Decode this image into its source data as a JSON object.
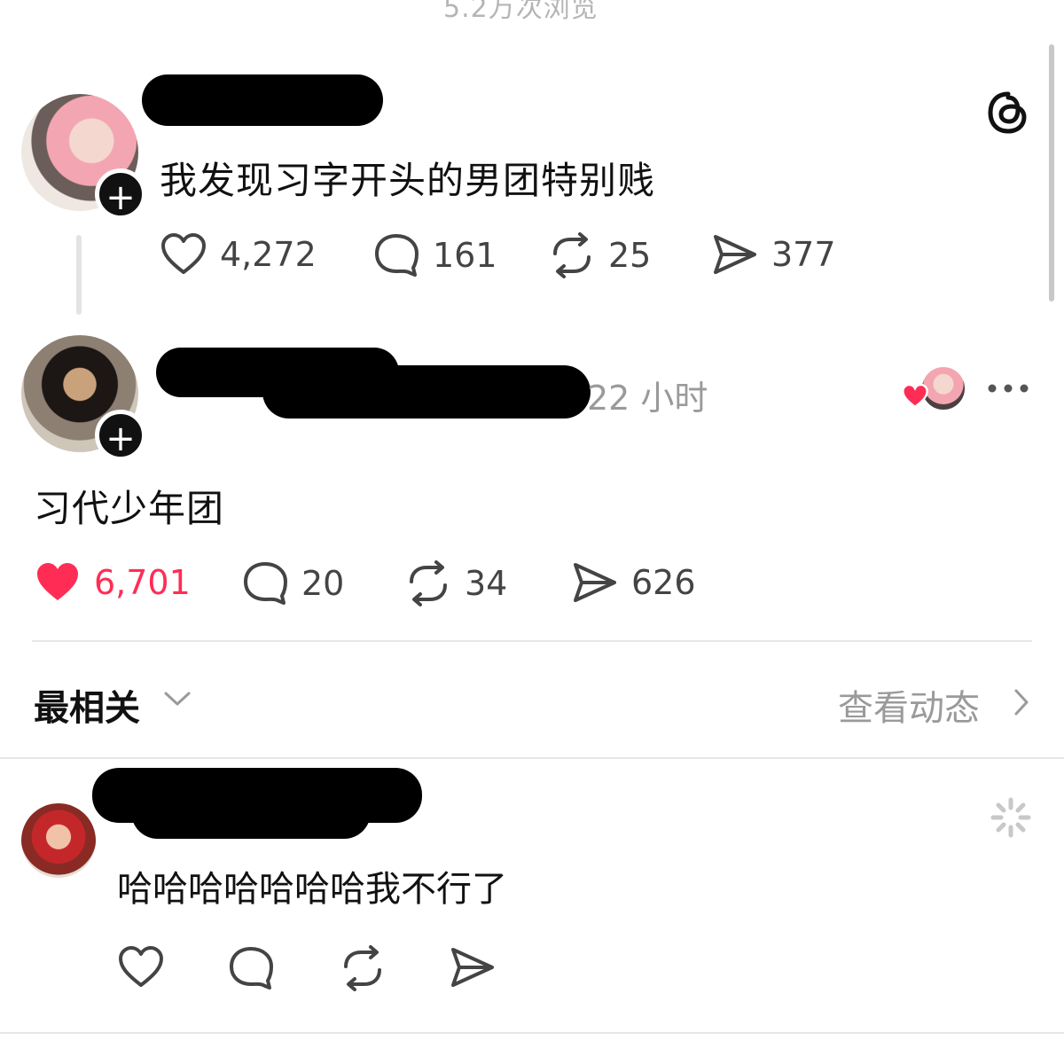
{
  "header": {
    "views_text": "5.2万次浏览"
  },
  "parent_post": {
    "text": "我发现习字开头的男团特别贱",
    "stats": {
      "likes": "4,272",
      "comments": "161",
      "reposts": "25",
      "shares": "377"
    }
  },
  "main_post": {
    "time": "22 小时",
    "text": "习代少年团",
    "liked": true,
    "stats": {
      "likes": "6,701",
      "comments": "20",
      "reposts": "34",
      "shares": "626"
    }
  },
  "replies_bar": {
    "sort_label": "最相关",
    "activity_label": "查看动态"
  },
  "reply": {
    "text": "哈哈哈哈哈哈哈我不行了"
  },
  "colors": {
    "like_active": "#ff2d55",
    "muted_text": "#9a9a9a",
    "icon_gray": "#444444"
  },
  "icons": {
    "threads": "threads-logo-icon",
    "like": "heart-icon",
    "comment": "comment-bubble-icon",
    "repost": "repost-icon",
    "share": "send-icon",
    "more": "more-dots-icon",
    "chevron_down": "chevron-down-icon",
    "chevron_right": "chevron-right-icon",
    "loading": "loading-spinner-icon"
  }
}
